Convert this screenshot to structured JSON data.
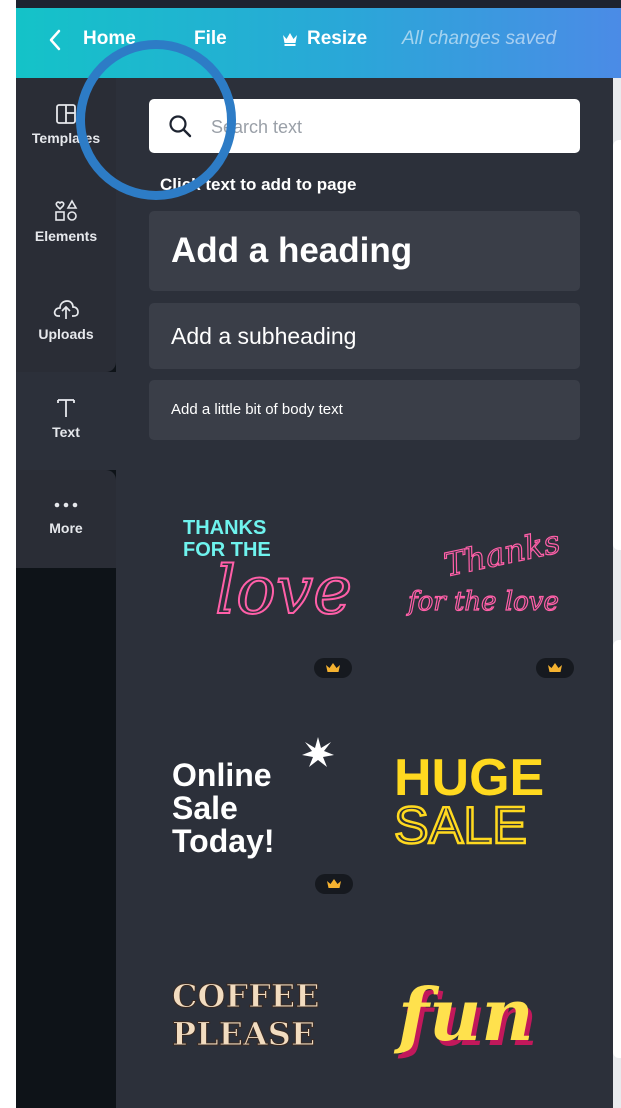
{
  "topbar": {
    "home_label": "Home",
    "file_label": "File",
    "resize_label": "Resize",
    "status": "All changes saved"
  },
  "sidebar": {
    "items": [
      {
        "label": "Templates",
        "icon": "templates-icon"
      },
      {
        "label": "Elements",
        "icon": "elements-icon"
      },
      {
        "label": "Uploads",
        "icon": "uploads-icon"
      },
      {
        "label": "Text",
        "icon": "text-icon"
      },
      {
        "label": "More",
        "icon": "more-icon"
      }
    ]
  },
  "panel": {
    "search_placeholder": "Search text",
    "hint": "Click text to add to page",
    "heading": "Add a heading",
    "subheading": "Add a subheading",
    "body": "Add a little bit of body text"
  },
  "templates": [
    {
      "name": "thanks-for-the-love-neon",
      "lines": [
        "THANKS",
        "FOR THE",
        "love"
      ],
      "premium": true
    },
    {
      "name": "thanks-for-the-love-script",
      "lines": [
        "Thanks",
        "for the love"
      ],
      "premium": true
    },
    {
      "name": "online-sale-today",
      "lines": [
        "Online",
        "Sale",
        "Today!"
      ],
      "premium": true
    },
    {
      "name": "huge-sale",
      "lines": [
        "HUGE",
        "SALE"
      ],
      "premium": false
    },
    {
      "name": "coffee-please",
      "lines": [
        "COFFEE",
        "PLEASE"
      ],
      "premium": false
    },
    {
      "name": "fun",
      "lines": [
        "fun"
      ],
      "premium": false
    }
  ],
  "colors": {
    "topbar_gradient_start": "#14c3c8",
    "topbar_gradient_end": "#4b8be6",
    "sidebar_bg": "#0e1318",
    "panel_bg": "#2c303a",
    "neon_cyan": "#6ff3ee",
    "neon_pink": "#ff5fa8",
    "sale_yellow": "#ffd91f",
    "coffee_cream": "#f2dcc0",
    "fun_yellow": "#ffe14d",
    "highlight_circle": "#2d7cc6"
  }
}
